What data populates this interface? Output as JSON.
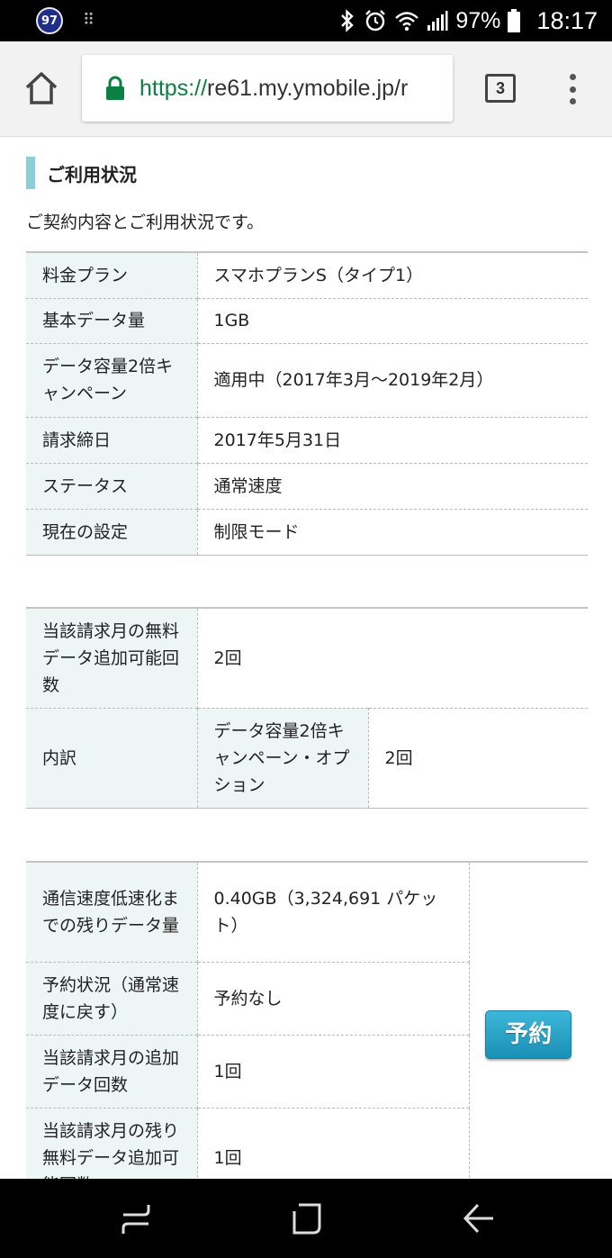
{
  "status_bar": {
    "badge": "97",
    "battery": "97%",
    "time": "18:17"
  },
  "browser": {
    "url_scheme": "https://",
    "url_host": "re61.my.ymobile.jp/r",
    "tab_count": "3"
  },
  "section": {
    "title": "ご利用状況",
    "intro": "ご契約内容とご利用状況です。"
  },
  "contract_table": [
    {
      "label": "料金プラン",
      "value": "スマホプランS（タイプ1）"
    },
    {
      "label": "基本データ量",
      "value": "1GB"
    },
    {
      "label": "データ容量2倍キャンペーン",
      "value": "適用中（2017年3月～2019年2月）"
    },
    {
      "label": "請求締日",
      "value": "2017年5月31日"
    },
    {
      "label": "ステータス",
      "value": "通常速度"
    },
    {
      "label": "現在の設定",
      "value": "制限モード"
    }
  ],
  "free_data_table": {
    "row1_label": "当該請求月の無料データ追加可能回数",
    "row1_value": "2回",
    "row2_label": "内訳",
    "row2_sublabel": "データ容量2倍キャンペーン・オプション",
    "row2_value": "2回"
  },
  "usage_table": [
    {
      "label": "通信速度低速化までの残りデータ量",
      "value": "0.40GB（3,324,691 パケット）"
    },
    {
      "label": "予約状況（通常速度に戻す）",
      "value": "予約なし"
    },
    {
      "label": "当該請求月の追加データ回数",
      "value": "1回"
    },
    {
      "label": "当該請求月の残り無料データ追加可能回数",
      "value": "1回"
    }
  ],
  "reserve_button": "予約"
}
